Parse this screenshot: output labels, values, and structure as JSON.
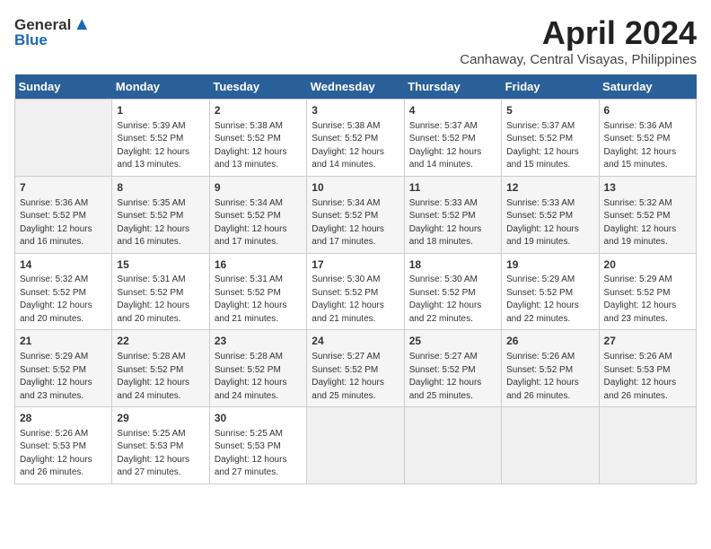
{
  "logo": {
    "general": "General",
    "blue": "Blue"
  },
  "title": {
    "month_year": "April 2024",
    "location": "Canhaway, Central Visayas, Philippines"
  },
  "calendar": {
    "headers": [
      "Sunday",
      "Monday",
      "Tuesday",
      "Wednesday",
      "Thursday",
      "Friday",
      "Saturday"
    ],
    "weeks": [
      [
        {
          "day": "",
          "info": ""
        },
        {
          "day": "1",
          "info": "Sunrise: 5:39 AM\nSunset: 5:52 PM\nDaylight: 12 hours\nand 13 minutes."
        },
        {
          "day": "2",
          "info": "Sunrise: 5:38 AM\nSunset: 5:52 PM\nDaylight: 12 hours\nand 13 minutes."
        },
        {
          "day": "3",
          "info": "Sunrise: 5:38 AM\nSunset: 5:52 PM\nDaylight: 12 hours\nand 14 minutes."
        },
        {
          "day": "4",
          "info": "Sunrise: 5:37 AM\nSunset: 5:52 PM\nDaylight: 12 hours\nand 14 minutes."
        },
        {
          "day": "5",
          "info": "Sunrise: 5:37 AM\nSunset: 5:52 PM\nDaylight: 12 hours\nand 15 minutes."
        },
        {
          "day": "6",
          "info": "Sunrise: 5:36 AM\nSunset: 5:52 PM\nDaylight: 12 hours\nand 15 minutes."
        }
      ],
      [
        {
          "day": "7",
          "info": "Sunrise: 5:36 AM\nSunset: 5:52 PM\nDaylight: 12 hours\nand 16 minutes."
        },
        {
          "day": "8",
          "info": "Sunrise: 5:35 AM\nSunset: 5:52 PM\nDaylight: 12 hours\nand 16 minutes."
        },
        {
          "day": "9",
          "info": "Sunrise: 5:34 AM\nSunset: 5:52 PM\nDaylight: 12 hours\nand 17 minutes."
        },
        {
          "day": "10",
          "info": "Sunrise: 5:34 AM\nSunset: 5:52 PM\nDaylight: 12 hours\nand 17 minutes."
        },
        {
          "day": "11",
          "info": "Sunrise: 5:33 AM\nSunset: 5:52 PM\nDaylight: 12 hours\nand 18 minutes."
        },
        {
          "day": "12",
          "info": "Sunrise: 5:33 AM\nSunset: 5:52 PM\nDaylight: 12 hours\nand 19 minutes."
        },
        {
          "day": "13",
          "info": "Sunrise: 5:32 AM\nSunset: 5:52 PM\nDaylight: 12 hours\nand 19 minutes."
        }
      ],
      [
        {
          "day": "14",
          "info": "Sunrise: 5:32 AM\nSunset: 5:52 PM\nDaylight: 12 hours\nand 20 minutes."
        },
        {
          "day": "15",
          "info": "Sunrise: 5:31 AM\nSunset: 5:52 PM\nDaylight: 12 hours\nand 20 minutes."
        },
        {
          "day": "16",
          "info": "Sunrise: 5:31 AM\nSunset: 5:52 PM\nDaylight: 12 hours\nand 21 minutes."
        },
        {
          "day": "17",
          "info": "Sunrise: 5:30 AM\nSunset: 5:52 PM\nDaylight: 12 hours\nand 21 minutes."
        },
        {
          "day": "18",
          "info": "Sunrise: 5:30 AM\nSunset: 5:52 PM\nDaylight: 12 hours\nand 22 minutes."
        },
        {
          "day": "19",
          "info": "Sunrise: 5:29 AM\nSunset: 5:52 PM\nDaylight: 12 hours\nand 22 minutes."
        },
        {
          "day": "20",
          "info": "Sunrise: 5:29 AM\nSunset: 5:52 PM\nDaylight: 12 hours\nand 23 minutes."
        }
      ],
      [
        {
          "day": "21",
          "info": "Sunrise: 5:29 AM\nSunset: 5:52 PM\nDaylight: 12 hours\nand 23 minutes."
        },
        {
          "day": "22",
          "info": "Sunrise: 5:28 AM\nSunset: 5:52 PM\nDaylight: 12 hours\nand 24 minutes."
        },
        {
          "day": "23",
          "info": "Sunrise: 5:28 AM\nSunset: 5:52 PM\nDaylight: 12 hours\nand 24 minutes."
        },
        {
          "day": "24",
          "info": "Sunrise: 5:27 AM\nSunset: 5:52 PM\nDaylight: 12 hours\nand 25 minutes."
        },
        {
          "day": "25",
          "info": "Sunrise: 5:27 AM\nSunset: 5:52 PM\nDaylight: 12 hours\nand 25 minutes."
        },
        {
          "day": "26",
          "info": "Sunrise: 5:26 AM\nSunset: 5:52 PM\nDaylight: 12 hours\nand 26 minutes."
        },
        {
          "day": "27",
          "info": "Sunrise: 5:26 AM\nSunset: 5:53 PM\nDaylight: 12 hours\nand 26 minutes."
        }
      ],
      [
        {
          "day": "28",
          "info": "Sunrise: 5:26 AM\nSunset: 5:53 PM\nDaylight: 12 hours\nand 26 minutes."
        },
        {
          "day": "29",
          "info": "Sunrise: 5:25 AM\nSunset: 5:53 PM\nDaylight: 12 hours\nand 27 minutes."
        },
        {
          "day": "30",
          "info": "Sunrise: 5:25 AM\nSunset: 5:53 PM\nDaylight: 12 hours\nand 27 minutes."
        },
        {
          "day": "",
          "info": ""
        },
        {
          "day": "",
          "info": ""
        },
        {
          "day": "",
          "info": ""
        },
        {
          "day": "",
          "info": ""
        }
      ]
    ]
  }
}
